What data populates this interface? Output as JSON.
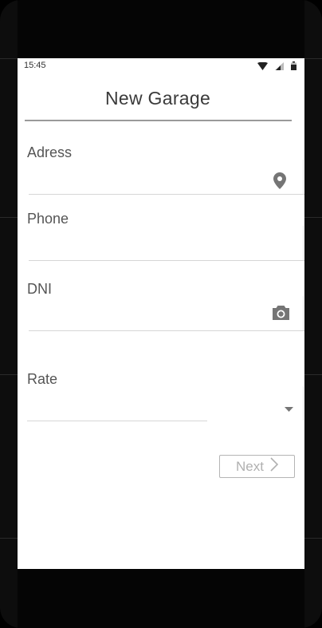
{
  "status_bar": {
    "time": "15:45",
    "icons": [
      "wifi-icon",
      "cellular-icon",
      "battery-icon"
    ]
  },
  "header": {
    "title": "New Garage"
  },
  "form": {
    "address": {
      "label": "Adress",
      "value": "",
      "icon": "location-pin-icon"
    },
    "phone": {
      "label": "Phone",
      "value": ""
    },
    "dni": {
      "label": "DNI",
      "value": "",
      "icon": "camera-icon"
    },
    "rate": {
      "label": "Rate",
      "selected": "",
      "icon": "dropdown-arrow-icon"
    }
  },
  "actions": {
    "next_label": "Next",
    "next_icon": "chevron-right-icon",
    "next_enabled": false
  },
  "colors": {
    "text_primary": "#3a3a3a",
    "label": "#555555",
    "icon": "#757575",
    "disabled": "#b0b0b0",
    "frame": "#050505"
  }
}
